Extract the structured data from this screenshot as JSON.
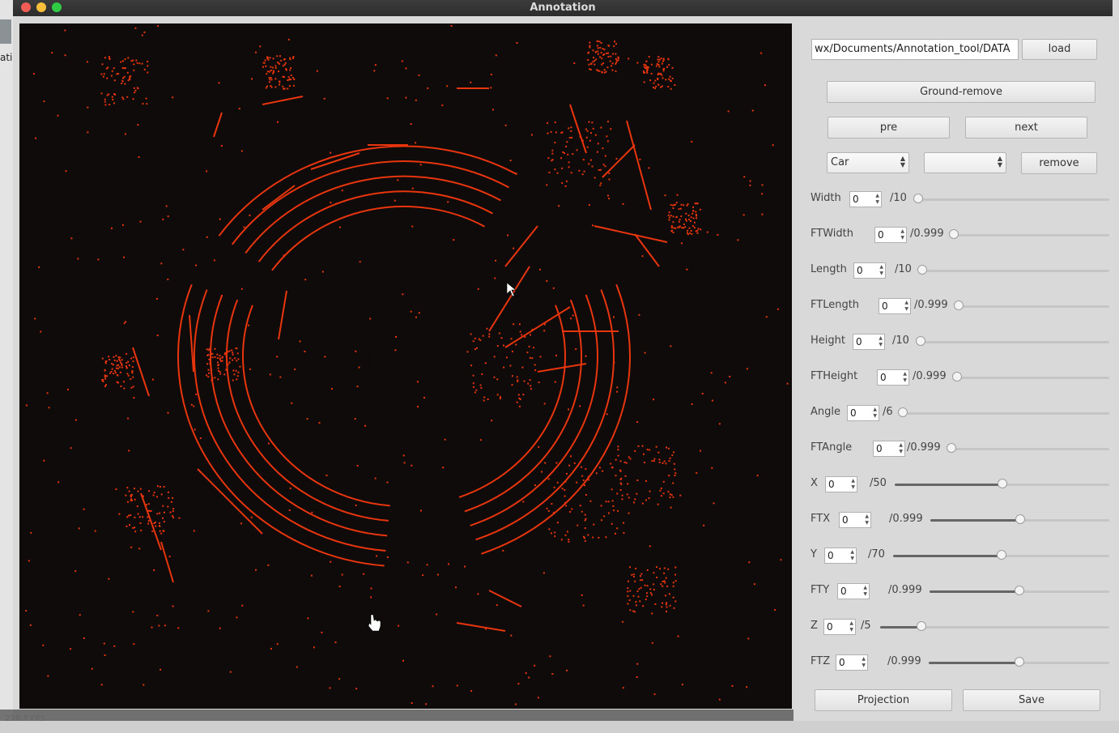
{
  "window": {
    "title": "Annotation"
  },
  "desktop": {
    "left_text": "ati"
  },
  "viewport": {
    "fps": "228.7 FPS",
    "point_color": "#e8350e",
    "background": "#0e0b0a"
  },
  "panel": {
    "path_value": "wx/Documents/Annotation_tool/DATA",
    "load_label": "load",
    "ground_remove_label": "Ground-remove",
    "pre_label": "pre",
    "next_label": "next",
    "class_select": "Car",
    "second_select": "",
    "remove_label": "remove",
    "projection_label": "Projection",
    "save_label": "Save"
  },
  "params": [
    {
      "label": "Width",
      "value": "0",
      "max": "/10",
      "level": 0.0
    },
    {
      "label": "FTWidth",
      "value": "0",
      "max": "/0.999",
      "level": 0.0
    },
    {
      "label": "Length",
      "value": "0",
      "max": "/10",
      "level": 0.0
    },
    {
      "label": "FTLength",
      "value": "0",
      "max": "/0.999",
      "level": 0.0
    },
    {
      "label": "Height",
      "value": "0",
      "max": "/10",
      "level": 0.0
    },
    {
      "label": "FTHeight",
      "value": "0",
      "max": "/0.999",
      "level": 0.0
    },
    {
      "label": "Angle",
      "value": "0",
      "max": "/6",
      "level": 0.0
    },
    {
      "label": "FTAngle",
      "value": "0",
      "max": "/0.999",
      "level": 0.0
    },
    {
      "label": "X",
      "value": "0",
      "max": "/50",
      "level": 0.5
    },
    {
      "label": "FTX",
      "value": "0",
      "max": "/0.999",
      "level": 0.5
    },
    {
      "label": "Y",
      "value": "0",
      "max": "/70",
      "level": 0.5
    },
    {
      "label": "FTY",
      "value": "0",
      "max": "/0.999",
      "level": 0.5
    },
    {
      "label": "Z",
      "value": "0",
      "max": "/5",
      "level": 0.18
    },
    {
      "label": "FTZ",
      "value": "0",
      "max": "/0.999",
      "level": 0.5
    }
  ]
}
